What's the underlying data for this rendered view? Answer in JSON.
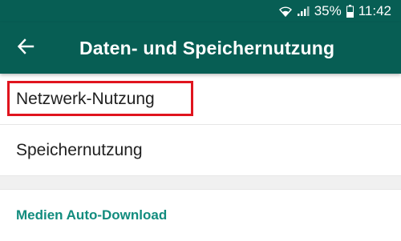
{
  "status_bar": {
    "wifi_icon": "wifi-icon",
    "signal_icon": "signal-icon",
    "battery_percent": "35%",
    "battery_icon": "battery-icon",
    "time": "11:42"
  },
  "app_bar": {
    "back_icon": "arrow-back-icon",
    "title": "Daten- und Speichernutzung",
    "color": "#075e54"
  },
  "list": {
    "items": [
      {
        "label": "Netzwerk-Nutzung",
        "highlighted": true
      },
      {
        "label": "Speichernutzung",
        "highlighted": false
      }
    ]
  },
  "section": {
    "header": "Medien Auto-Download",
    "accent_color": "#128c7e"
  },
  "highlight_color": "#e0141e"
}
